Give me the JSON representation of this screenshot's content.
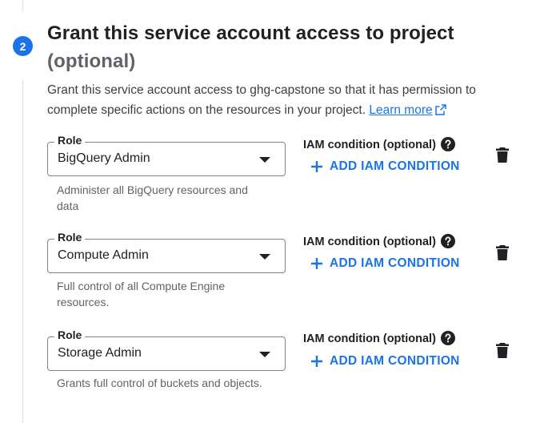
{
  "step": {
    "number": "2",
    "title": "Grant this service account access to project",
    "title_optional": "(optional)",
    "description": "Grant this service account access to ghg-capstone so that it has permission to complete specific actions on the resources in your project.",
    "learn_more": "Learn more"
  },
  "roles": [
    {
      "label": "Role",
      "value": "BigQuery Admin",
      "help": "Administer all BigQuery resources and data",
      "iam_label": "IAM condition (optional)",
      "add_label": "ADD IAM CONDITION"
    },
    {
      "label": "Role",
      "value": "Compute Admin",
      "help": "Full control of all Compute Engine resources.",
      "iam_label": "IAM condition (optional)",
      "add_label": "ADD IAM CONDITION"
    },
    {
      "label": "Role",
      "value": "Storage Admin",
      "help": "Grants full control of buckets and objects.",
      "iam_label": "IAM condition (optional)",
      "add_label": "ADD IAM CONDITION"
    }
  ],
  "colors": {
    "accent": "#1a73e8",
    "text": "#202124",
    "secondary_text": "#5f6368"
  }
}
